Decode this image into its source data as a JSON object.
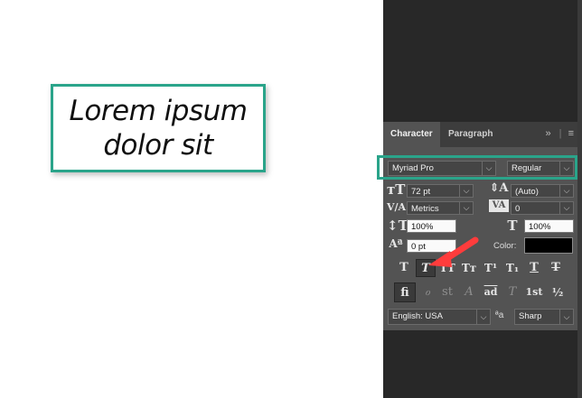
{
  "canvas": {
    "line1": "Lorem ipsum",
    "line2": "dolor sit"
  },
  "panel": {
    "tabs": [
      {
        "label": "Character"
      },
      {
        "label": "Paragraph"
      }
    ],
    "font_family": "Myriad Pro",
    "font_style": "Regular",
    "font_size": "72 pt",
    "leading": "(Auto)",
    "kerning": "Metrics",
    "tracking": "0",
    "vertical_scale": "100%",
    "horizontal_scale": "100%",
    "baseline_shift": "0 pt",
    "color_label": "Color:",
    "color_value": "#000000",
    "style_buttons": [
      "T",
      "T",
      "TT",
      "Tт",
      "T¹",
      "T₁",
      "T",
      "T"
    ],
    "opentype_buttons": [
      "fi",
      "ℴ",
      "st",
      "A",
      "ad",
      "T",
      "1st",
      "½"
    ],
    "language": "English: USA",
    "aa_label": "ªa",
    "antialias": "Sharp"
  },
  "accent_color": "#2aa48a",
  "arrow_color": "#ff3c3c"
}
